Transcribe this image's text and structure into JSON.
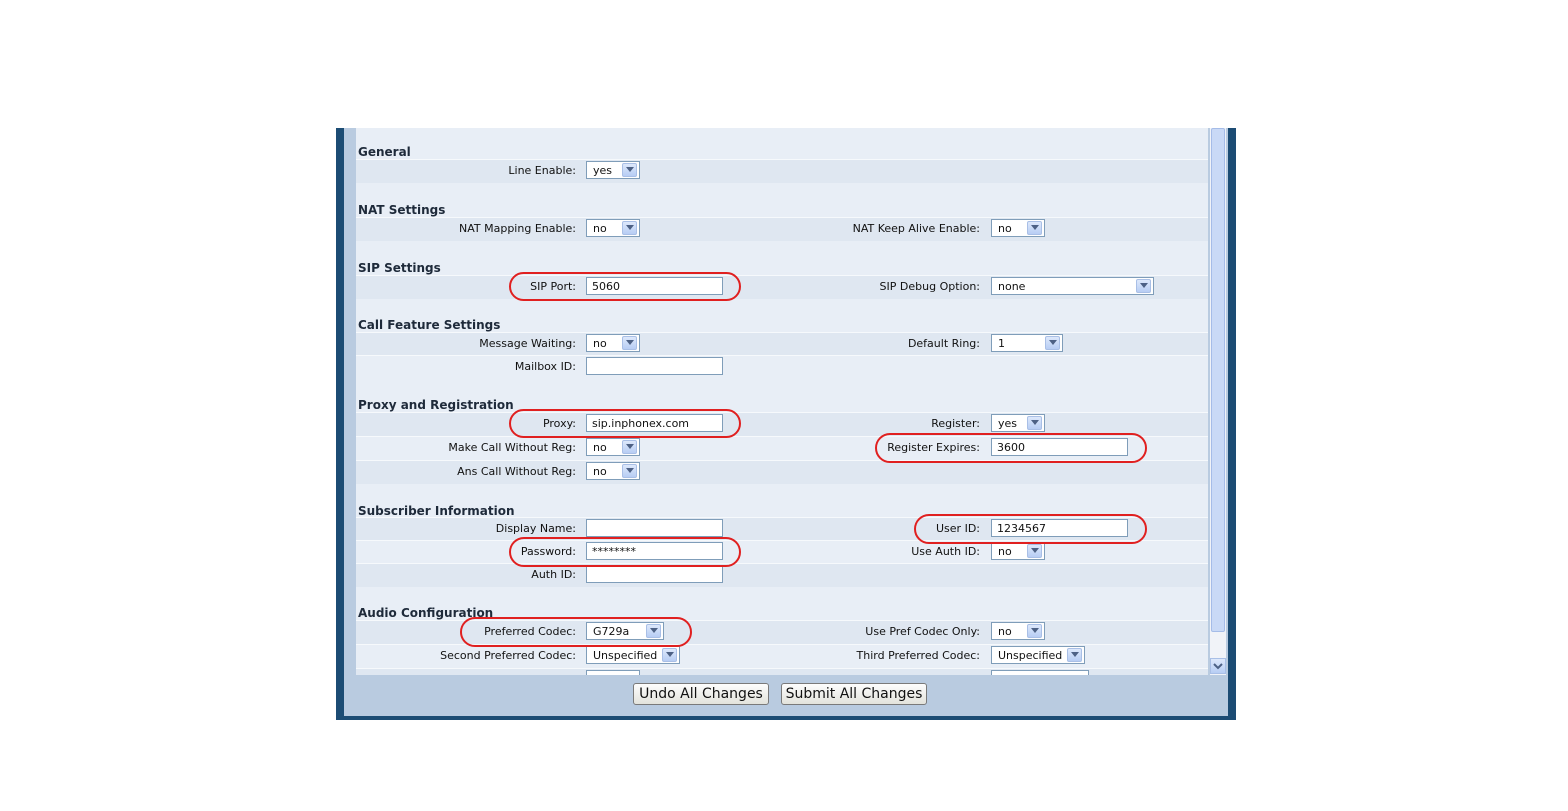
{
  "sections": {
    "general": "General",
    "nat": "NAT Settings",
    "sip": "SIP Settings",
    "call_feature": "Call Feature Settings",
    "proxy": "Proxy and Registration",
    "subscriber": "Subscriber Information",
    "audio": "Audio Configuration"
  },
  "fields": {
    "line_enable": {
      "label": "Line Enable:",
      "value": "yes"
    },
    "nat_mapping_enable": {
      "label": "NAT Mapping Enable:",
      "value": "no"
    },
    "nat_keep_alive_enable": {
      "label": "NAT Keep Alive Enable:",
      "value": "no"
    },
    "sip_port": {
      "label": "SIP Port:",
      "value": "5060"
    },
    "sip_debug_option": {
      "label": "SIP Debug Option:",
      "value": "none"
    },
    "message_waiting": {
      "label": "Message Waiting:",
      "value": "no"
    },
    "default_ring": {
      "label": "Default Ring:",
      "value": "1"
    },
    "mailbox_id": {
      "label": "Mailbox ID:",
      "value": ""
    },
    "proxy": {
      "label": "Proxy:",
      "value": "sip.inphonex.com"
    },
    "register": {
      "label": "Register:",
      "value": "yes"
    },
    "make_call_without_reg": {
      "label": "Make Call Without Reg:",
      "value": "no"
    },
    "register_expires": {
      "label": "Register Expires:",
      "value": "3600"
    },
    "ans_call_without_reg": {
      "label": "Ans Call Without Reg:",
      "value": "no"
    },
    "display_name": {
      "label": "Display Name:",
      "value": ""
    },
    "user_id": {
      "label": "User ID:",
      "value": "1234567"
    },
    "password": {
      "label": "Password:",
      "value": "********"
    },
    "use_auth_id": {
      "label": "Use Auth ID:",
      "value": "no"
    },
    "auth_id": {
      "label": "Auth ID:",
      "value": ""
    },
    "preferred_codec": {
      "label": "Preferred Codec:",
      "value": "G729a"
    },
    "use_pref_codec_only": {
      "label": "Use Pref Codec Only:",
      "value": "no"
    },
    "second_preferred_codec": {
      "label": "Second Preferred Codec:",
      "value": "Unspecified"
    },
    "third_preferred_codec": {
      "label": "Third Preferred Codec:",
      "value": "Unspecified"
    }
  },
  "buttons": {
    "undo": "Undo All Changes",
    "submit": "Submit All Changes"
  },
  "icons": {
    "dropdown": "chevron-down-icon",
    "scroll_down": "scroll-down-arrow-icon"
  },
  "colors": {
    "frame": "#1c4c74",
    "panel": "#e8eef6",
    "highlight_ring": "#e02020"
  }
}
